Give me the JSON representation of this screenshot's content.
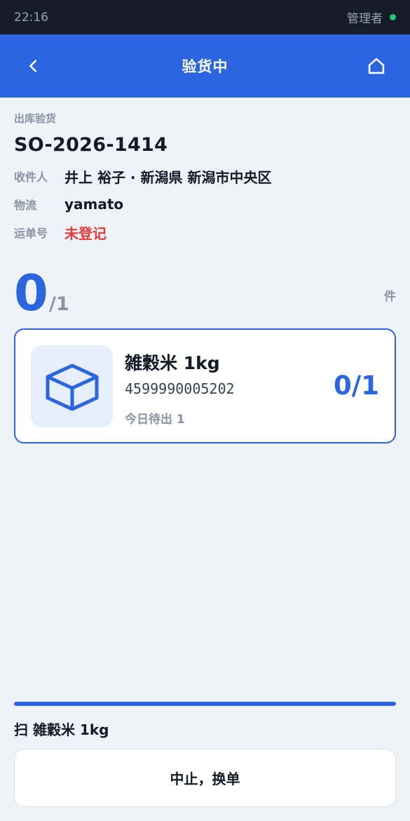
{
  "status_bar": {
    "time": "22:16",
    "user": "管理者",
    "online_color": "#22c77a"
  },
  "header": {
    "title": "验货中",
    "back_icon": "chevron-left-icon",
    "home_icon": "home-icon"
  },
  "order": {
    "section_label": "出库验货",
    "order_no": "SO-2026-1414",
    "recipient_label": "收件人",
    "recipient_value": "井上 裕子 · 新潟県 新潟市中央区",
    "logistics_label": "物流",
    "logistics_value": "yamato",
    "tracking_label": "运单号",
    "tracking_value": "未登记"
  },
  "counter": {
    "scanned": "0",
    "total": "/1",
    "unit": "件"
  },
  "items": [
    {
      "name": "雑穀米 1kg",
      "barcode": "4599990005202",
      "today": "今日待出 1",
      "qty": "0/1",
      "icon": "box-icon"
    }
  ],
  "progress": {
    "fraction": 1.0
  },
  "bottom": {
    "scan_hint": "扫 雑穀米 1kg",
    "abort_label": "中止，换单"
  },
  "colors": {
    "accent": "#2b66e0",
    "danger": "#e53935",
    "status_bar_bg": "#151b27"
  }
}
